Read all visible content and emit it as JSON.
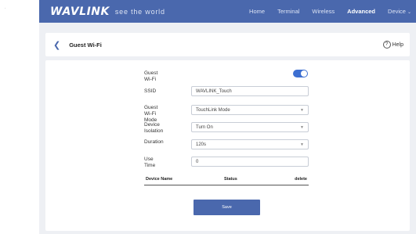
{
  "app": {
    "logo": "WAVLINK",
    "tagline": "see the world"
  },
  "nav": {
    "items": [
      {
        "label": "Home",
        "active": false
      },
      {
        "label": "Terminal",
        "active": false
      },
      {
        "label": "Wireless",
        "active": false
      },
      {
        "label": "Advanced",
        "active": true
      },
      {
        "label": "Device",
        "active": false
      }
    ],
    "device_caret": "⌄"
  },
  "header": {
    "back_icon": "chevron-left-icon",
    "title": "Guest Wi-Fi",
    "help_label": "Help"
  },
  "form": {
    "guest_wifi": {
      "label": "Guest Wi-Fi",
      "enabled": true
    },
    "ssid": {
      "label": "SSID",
      "value": "WAVLINK_Touch"
    },
    "mode": {
      "label": "Guest Wi-Fi\nMode",
      "value": "TouchLink Mode"
    },
    "isolation": {
      "label": "Device Isolation",
      "value": "Turn On"
    },
    "duration": {
      "label": "Duration",
      "value": "120s"
    },
    "use_time": {
      "label": "Use Time",
      "value": "0"
    }
  },
  "table": {
    "columns": [
      "Device Name",
      "Status",
      "delete"
    ],
    "rows": []
  },
  "actions": {
    "save_label": "Save"
  },
  "colors": {
    "primary": "#4a68ad",
    "toggle_on": "#3d6fd1"
  }
}
